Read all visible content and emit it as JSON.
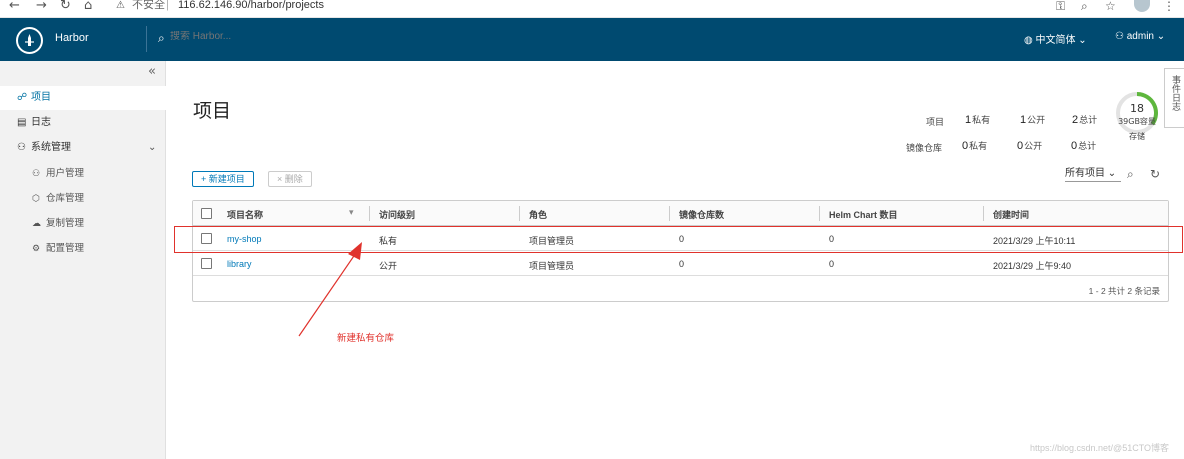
{
  "browser": {
    "insecure_label": "不安全",
    "url": "116.62.146.90/harbor/projects"
  },
  "header": {
    "brand": "Harbor",
    "search_placeholder": "搜索 Harbor...",
    "language": "中文简体",
    "user": "admin"
  },
  "sidebar": {
    "items": [
      {
        "label": "项目"
      },
      {
        "label": "日志"
      },
      {
        "label": "系统管理"
      }
    ],
    "sub_items": [
      {
        "label": "用户管理"
      },
      {
        "label": "仓库管理"
      },
      {
        "label": "复制管理"
      },
      {
        "label": "配置管理"
      }
    ]
  },
  "page": {
    "title": "项目",
    "event_tab": "事件日志"
  },
  "stats": {
    "projects_label": "项目",
    "repos_label": "镜像仓库",
    "project_private": "1",
    "project_public": "1",
    "project_total": "2",
    "repo_private": "0",
    "repo_public": "0",
    "repo_total": "0",
    "private_label": "私有",
    "public_label": "公开",
    "total_label": "总计",
    "storage_count": "18",
    "storage_capacity": "39GB容量",
    "storage_label": "存储",
    "storage_used_fraction": 0.35
  },
  "toolbar": {
    "new_project": "+ 新建项目",
    "delete": "× 删除",
    "filter": "所有项目"
  },
  "table": {
    "headers": [
      "项目名称",
      "访问级别",
      "角色",
      "镜像仓库数",
      "Helm Chart 数目",
      "创建时间"
    ],
    "rows": [
      [
        "my-shop",
        "私有",
        "项目管理员",
        "0",
        "0",
        "2021/3/29 上午10:11"
      ],
      [
        "library",
        "公开",
        "项目管理员",
        "0",
        "0",
        "2021/3/29 上午9:40"
      ]
    ],
    "footer": "1 - 2 共计 2 条记录"
  },
  "annotation": "新建私有仓库",
  "watermark": "https://blog.csdn.net/@51CTO博客",
  "colors": {
    "header_bg": "#004a70",
    "accent": "#0079b8",
    "annotation": "#e0322c",
    "gauge": "#5eb73d"
  }
}
